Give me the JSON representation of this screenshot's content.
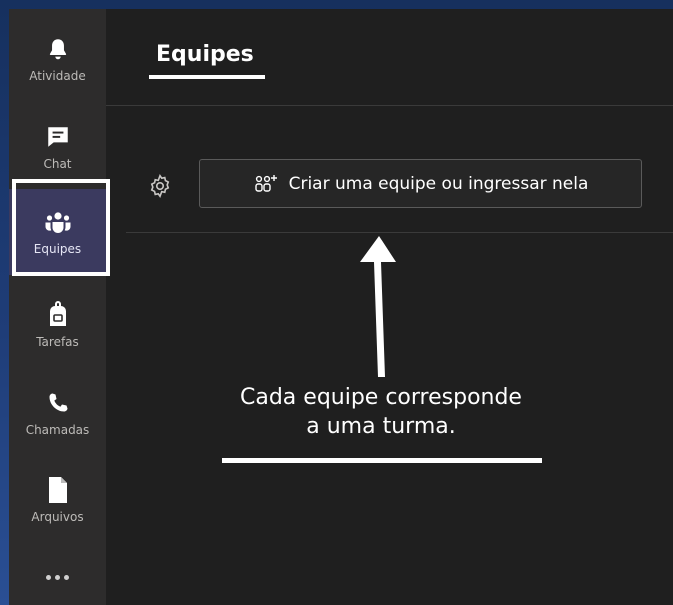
{
  "rail": {
    "items": [
      {
        "label": "Atividade",
        "icon": "bell-icon"
      },
      {
        "label": "Chat",
        "icon": "chat-icon"
      },
      {
        "label": "Equipes",
        "icon": "teams-icon"
      },
      {
        "label": "Tarefas",
        "icon": "backpack-icon"
      },
      {
        "label": "Chamadas",
        "icon": "phone-icon"
      },
      {
        "label": "Arquivos",
        "icon": "file-icon"
      }
    ],
    "active": "Equipes",
    "more_icon": "more-icon"
  },
  "header": {
    "title": "Equipes"
  },
  "actions": {
    "settings_icon": "gear-icon",
    "join_button_label": "Criar uma equipe ou ingressar nela",
    "join_button_icon": "add-team-icon"
  },
  "annotation": {
    "line1": "Cada equipe corresponde",
    "line2": "a uma turma."
  },
  "colors": {
    "rail_bg": "#2d2c2c",
    "main_bg": "#1f1f1f",
    "active_item_bg": "#3b3a5f",
    "highlight": "#ffffff"
  }
}
